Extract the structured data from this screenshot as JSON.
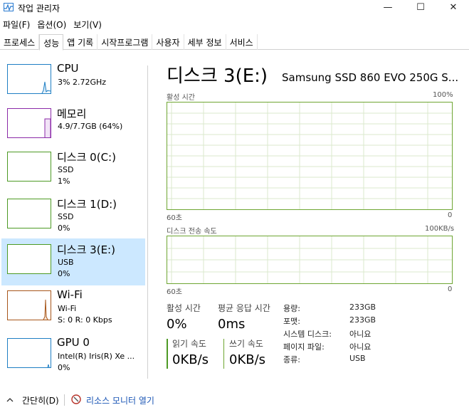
{
  "window": {
    "title": "작업 관리자",
    "minimize": "—",
    "maximize": "☐",
    "close": "✕"
  },
  "menu": [
    "파일(F)",
    "옵션(O)",
    "보기(V)"
  ],
  "tabs": [
    "프로세스",
    "성능",
    "앱 기록",
    "시작프로그램",
    "사용자",
    "세부 정보",
    "서비스"
  ],
  "active_tab": "성능",
  "sidebar": {
    "items": [
      {
        "name": "CPU",
        "line2": "3% 2.72GHz",
        "line3": "",
        "color": "#1f7fc4"
      },
      {
        "name": "메모리",
        "line2": "4.9/7.7GB (64%)",
        "line3": "",
        "color": "#8b2aa8"
      },
      {
        "name": "디스크 0(C:)",
        "line2": "SSD",
        "line3": "1%",
        "color": "#4d9a24"
      },
      {
        "name": "디스크 1(D:)",
        "line2": "SSD",
        "line3": "0%",
        "color": "#4d9a24"
      },
      {
        "name": "디스크 3(E:)",
        "line2": "USB",
        "line3": "0%",
        "color": "#4d9a24"
      },
      {
        "name": "Wi-Fi",
        "line2": "Wi-Fi",
        "line3": "S: 0 R: 0 Kbps",
        "color": "#a7561a"
      },
      {
        "name": "GPU 0",
        "line2": "Intel(R) Iris(R) Xe ...",
        "line3": "0%",
        "color": "#1f7fc4"
      }
    ],
    "selected_index": 4
  },
  "main": {
    "title": "디스크 3(E:)",
    "model": "Samsung SSD 860 EVO 250G S...",
    "graph1": {
      "label": "활성 시간",
      "max": "100%",
      "time": "60초",
      "min": "0"
    },
    "graph2": {
      "label": "디스크 전송 속도",
      "max": "100KB/s",
      "time": "60초",
      "min": "0"
    },
    "stats": {
      "active_label": "활성 시간",
      "active_value": "0%",
      "response_label": "평균 응답 시간",
      "response_value": "0ms",
      "read_label": "읽기 속도",
      "read_value": "0KB/s",
      "write_label": "쓰기 속도",
      "write_value": "0KB/s"
    },
    "properties": [
      {
        "label": "용량:",
        "value": "233GB"
      },
      {
        "label": "포맷:",
        "value": "233GB"
      },
      {
        "label": "시스템 디스크:",
        "value": "아니요"
      },
      {
        "label": "페이지 파일:",
        "value": "아니요"
      },
      {
        "label": "종류:",
        "value": "USB"
      }
    ]
  },
  "footer": {
    "collapse_label": "간단히(D)",
    "link_label": "리소스 모니터 열기"
  }
}
